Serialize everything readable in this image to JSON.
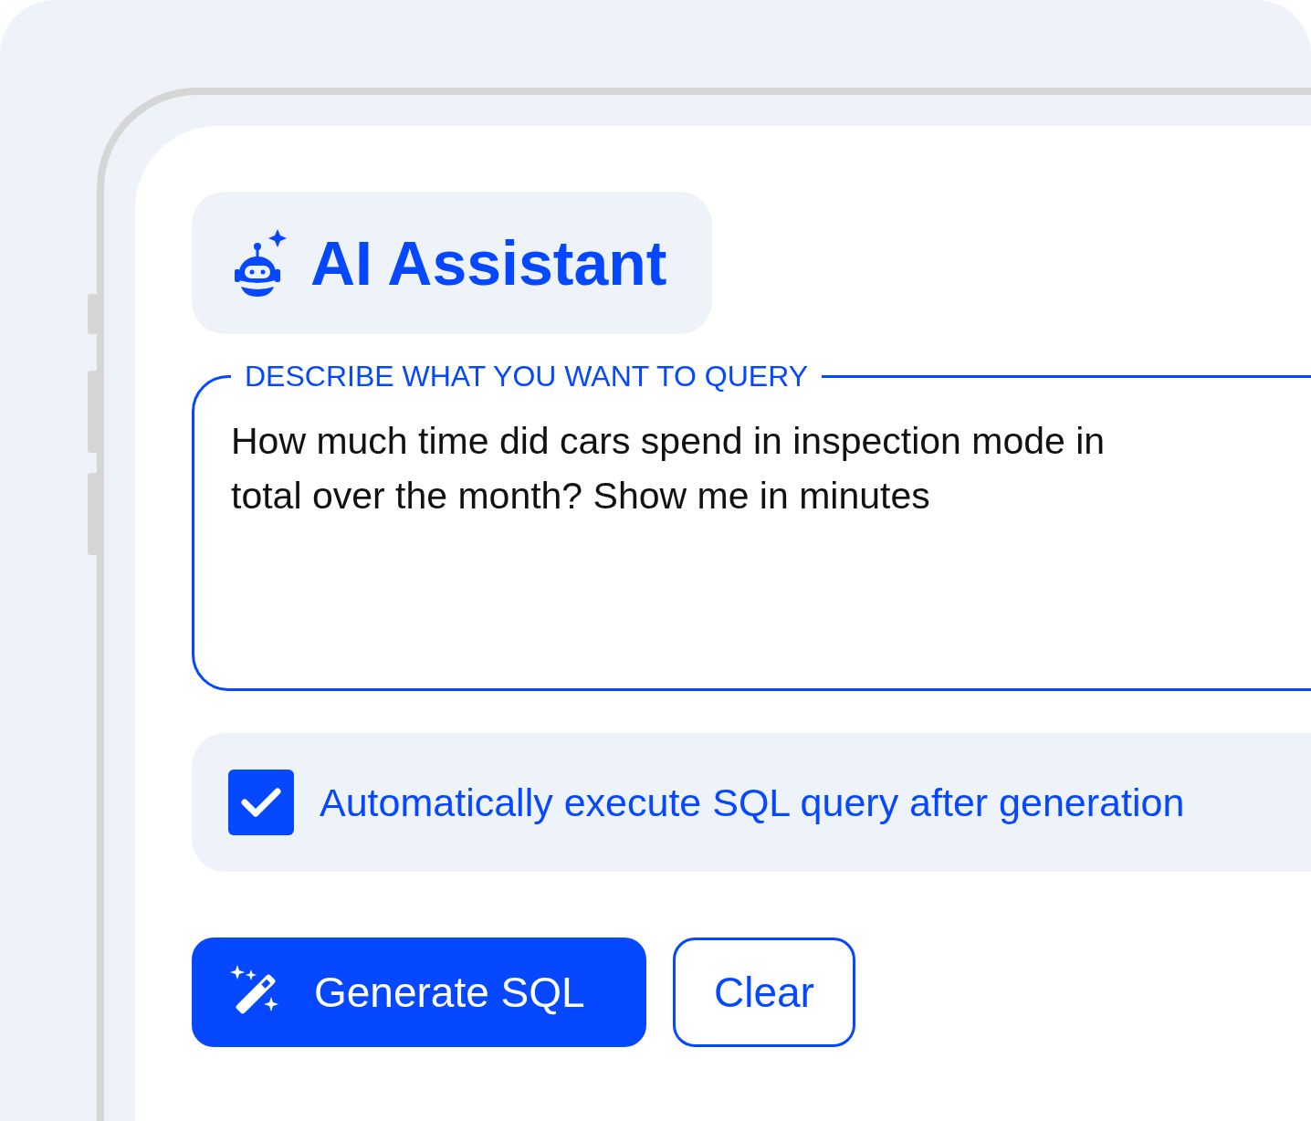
{
  "header": {
    "title": "AI Assistant"
  },
  "query": {
    "label": "DESCRIBE WHAT YOU WANT TO QUERY",
    "value": "How much time did cars spend in inspection mode in total over the month? Show me in minutes"
  },
  "auto_execute": {
    "label": "Automatically execute SQL query after generation",
    "checked": true
  },
  "buttons": [
    {
      "label": "Generate SQL",
      "kind": "primary"
    },
    {
      "label": "Clear",
      "kind": "secondary"
    }
  ]
}
